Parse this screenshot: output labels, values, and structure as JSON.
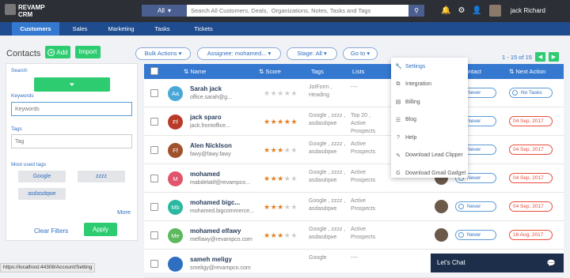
{
  "header": {
    "logo_line1": "REVAMP",
    "logo_line2": "CRM",
    "search_scope": "All",
    "search_placeholder": "Search All Customers, Deals,  Organizations, Notes, Tasks and Tags",
    "user_name": "jack Richard"
  },
  "nav": [
    "Customers",
    "Sales",
    "Marketing",
    "Tasks",
    "Tickets"
  ],
  "contacts": {
    "title": "Contacts",
    "add_label": "Add",
    "import_label": "Import"
  },
  "filters": {
    "search_label": "Search",
    "keywords_label": "Keywords",
    "keywords_placeholder": "Keywords",
    "tags_label": "Tags",
    "tag_placeholder": "Tag",
    "most_used_label": "Most used tags",
    "chips": [
      "Google",
      "zzzz",
      "asdasdqwe"
    ],
    "more": "More",
    "clear": "Clear Filters",
    "apply": "Apply"
  },
  "toolbar": {
    "bulk": "Bulk Actions",
    "assignee": "Assignee: mohamed...",
    "stage": "Stage: All",
    "goto": "Go to",
    "pager": "1 - 15 of 15"
  },
  "table": {
    "headers": {
      "name": "Name",
      "score": "Score",
      "tags": "Tags",
      "lists": "Lists",
      "last_contact": "t Contact",
      "next_action": "Next Action"
    },
    "rows": [
      {
        "initials": "Aa",
        "color": "#4aa8d8",
        "name": "Sarah jack",
        "email": "office.sarah@g...",
        "stars": 0,
        "tags": "JotForm , Heading",
        "lists": "----",
        "last": "Never",
        "next": "No Tasks",
        "next_red": false,
        "has_photo": false
      },
      {
        "initials": "Ff",
        "color": "#b83b2a",
        "name": "jack sparo",
        "email": "jack.frontoffice...",
        "stars": 5,
        "tags": "Google , zzzz , asdasdqwe",
        "lists": "Top 20 , Active Prospects",
        "last": "Never",
        "next": "04 Sep, 2017",
        "next_red": true,
        "has_photo": false
      },
      {
        "initials": "Ff",
        "color": "#a0522d",
        "name": "Alen Nicklson",
        "email": "fawy@fawy.fawy",
        "stars": 3,
        "tags": "Google , zzzz , asdasdqwe",
        "lists": "Active Prospects",
        "last": "Never",
        "next": "04 Sep, 2017",
        "next_red": true,
        "has_photo": true
      },
      {
        "initials": "M",
        "color": "#e0556b",
        "name": "mohamed",
        "email": "mabdelatif@revampco...",
        "stars": 3,
        "tags": "Google , zzzz , asdasdqwe",
        "lists": "Active Prospects",
        "last": "Never",
        "next": "04 Sep, 2017",
        "next_red": true,
        "has_photo": true
      },
      {
        "initials": "Mb",
        "color": "#2ab8a0",
        "name": "mohamed bigc...",
        "email": "mohamed.bigcommerce...",
        "stars": 3,
        "tags": "Google , zzzz , asdasdqwe",
        "lists": "Active Prospects",
        "last": "Never",
        "next": "04 Sep, 2017",
        "next_red": true,
        "has_photo": true
      },
      {
        "initials": "Me",
        "color": "#5cb85c",
        "name": "mohamed elfawy",
        "email": "melfawy@revampco.com",
        "stars": 3,
        "tags": "Google , zzzz , asdasdqwe",
        "lists": "Active Prospects",
        "last": "Never",
        "next": "16 Aug, 2017",
        "next_red": true,
        "has_photo": true
      },
      {
        "initials": "",
        "color": "#2f6fc1",
        "name": "sameh meligy",
        "email": "smeligy@revampco.com",
        "stars": 0,
        "tags": "Google",
        "lists": "----",
        "last": "",
        "next": "",
        "next_red": false,
        "has_photo": false
      }
    ]
  },
  "dropdown": [
    {
      "icon": "wrench-icon",
      "glyph": "🔧",
      "label": "Settings"
    },
    {
      "icon": "integration-icon",
      "glyph": "⧉",
      "label": "Integration"
    },
    {
      "icon": "billing-icon",
      "glyph": "▤",
      "label": "Billing"
    },
    {
      "icon": "rss-icon",
      "glyph": "☰",
      "label": "Blog"
    },
    {
      "icon": "help-icon",
      "glyph": "?",
      "label": "Help"
    },
    {
      "icon": "paperclip-icon",
      "glyph": "✎",
      "label": "Download Lead Clipper"
    },
    {
      "icon": "google-icon",
      "glyph": "G",
      "label": "Download Gmail Gadget"
    }
  ],
  "status_url": "https://localhost:44308/Account/Setting",
  "chat_label": "Let's Chat"
}
